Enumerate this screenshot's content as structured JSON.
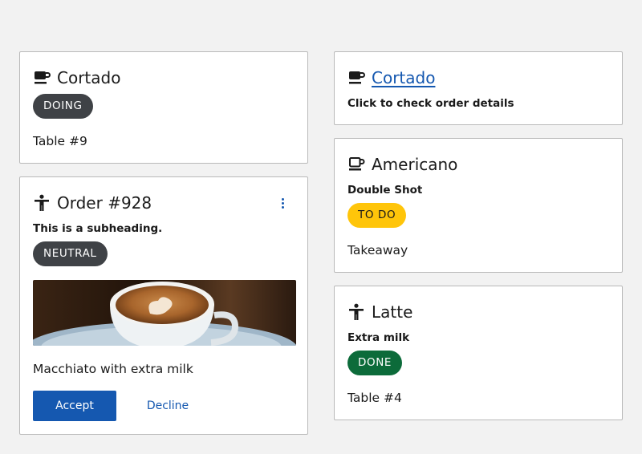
{
  "cards": {
    "cortado": {
      "title": "Cortado",
      "icon": "coffee-cup-icon",
      "badge": "DOING",
      "body": "Table #9"
    },
    "cortado_link": {
      "title": "Cortado",
      "icon": "coffee-cup-icon",
      "subheading": "Click to check order details"
    },
    "order": {
      "title": "Order #928",
      "icon": "person-icon",
      "subheading": "This is a subheading.",
      "badge": "NEUTRAL",
      "image": "cappuccino-photo",
      "body": "Macchiato with extra milk",
      "accept_label": "Accept",
      "decline_label": "Decline"
    },
    "americano": {
      "title": "Americano",
      "icon": "coffee-mug-outline-icon",
      "subheading": "Double Shot",
      "badge": "TO DO",
      "body": "Takeaway"
    },
    "latte": {
      "title": "Latte",
      "icon": "person-icon",
      "subheading": "Extra milk",
      "badge": "DONE",
      "body": "Table #4"
    }
  },
  "colors": {
    "link": "#1558b0",
    "badge_dark": "#3f4246",
    "badge_todo": "#ffc50a",
    "badge_done": "#0c6b3a",
    "button_primary": "#1558b0"
  }
}
